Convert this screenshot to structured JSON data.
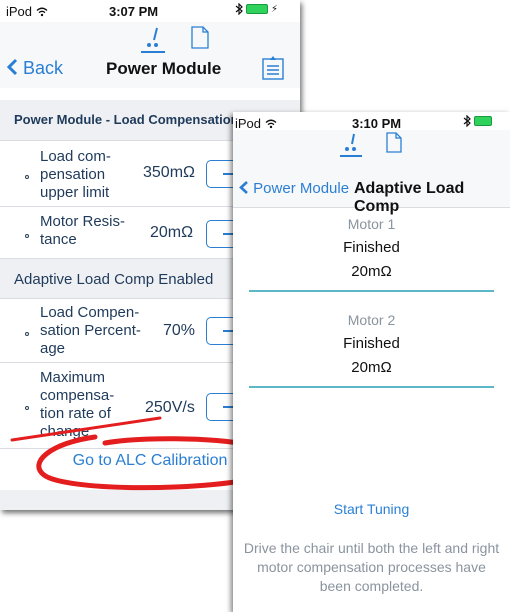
{
  "screen_a": {
    "status_bar": {
      "carrier": "iPod",
      "time": "3:07 PM"
    },
    "nav": {
      "back_label": "Back",
      "title": "Power Module"
    },
    "section_header": "Power Module - Load Compensation",
    "rows_1": [
      {
        "label": "Load com-\npensation\nupper limit",
        "value": "350mΩ"
      },
      {
        "label": "Motor Resis-\ntance",
        "value": "20mΩ"
      }
    ],
    "toggle_row": "Adaptive Load Comp Enabled",
    "rows_2": [
      {
        "label": "Load Compen-\nsation Percent-\nage",
        "value": "70%"
      },
      {
        "label": "Maximum\ncompensa-\ntion rate of\nchange",
        "value": "250V/s"
      }
    ],
    "calibration_link": "Go to ALC Calibration"
  },
  "screen_b": {
    "status_bar": {
      "carrier": "iPod",
      "time": "3:10 PM"
    },
    "nav": {
      "back_label": "Power Module",
      "title": "Adaptive Load Comp"
    },
    "motors": [
      {
        "name": "Motor 1",
        "status": "Finished",
        "resistance": "20mΩ"
      },
      {
        "name": "Motor 2",
        "status": "Finished",
        "resistance": "20mΩ"
      }
    ],
    "start_button": "Start Tuning",
    "instructions": "Drive the chair until both the left and right motor compensation processes have been completed."
  },
  "icons": {
    "segment_tool": "tuning-tool-icon",
    "segment_doc": "document-icon",
    "doc_button": "document-list-icon",
    "back": "chevron-left-icon",
    "wifi": "wifi-icon",
    "bluetooth": "bluetooth-icon",
    "battery": "battery-charging-icon"
  },
  "colors": {
    "accent": "#2a7fd4",
    "divider_teal": "#5cb7c9",
    "annotation_red": "#e41e1e",
    "battery_green": "#2fd25a"
  }
}
